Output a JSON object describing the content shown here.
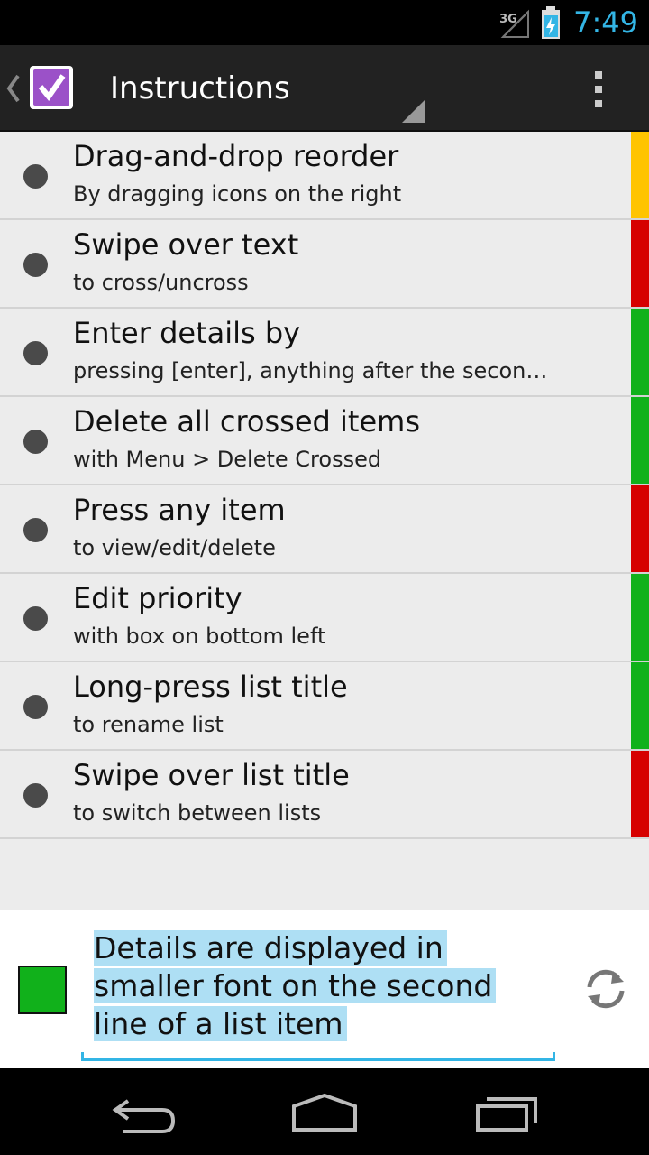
{
  "status_bar": {
    "network_type": "3G",
    "time": "7:49",
    "icons": [
      "signal-icon",
      "battery-charging-icon"
    ]
  },
  "action_bar": {
    "title": "Instructions",
    "icons": [
      "up-caret-icon",
      "app-checkbox-icon",
      "spinner-corner-icon",
      "overflow-menu-icon"
    ]
  },
  "list": {
    "items": [
      {
        "title": "Drag-and-drop reorder",
        "subtitle": "By dragging icons on the right",
        "priority_color": "#ffc400"
      },
      {
        "title": "Swipe over text",
        "subtitle": "to cross/uncross",
        "priority_color": "#d60000"
      },
      {
        "title": "Enter details by",
        "subtitle": "pressing [enter], anything after the secon…",
        "priority_color": "#11b11b"
      },
      {
        "title": "Delete all crossed items",
        "subtitle": "with Menu > Delete Crossed",
        "priority_color": "#11b11b"
      },
      {
        "title": "Press any item",
        "subtitle": "to view/edit/delete",
        "priority_color": "#d60000"
      },
      {
        "title": "Edit priority",
        "subtitle": "with box on bottom left",
        "priority_color": "#11b11b"
      },
      {
        "title": "Long-press list title",
        "subtitle": "to rename list",
        "priority_color": "#11b11b"
      },
      {
        "title": "Swipe over list title",
        "subtitle": "to switch between lists",
        "priority_color": "#d60000"
      }
    ]
  },
  "editor": {
    "priority_color": "#11b11b",
    "text_value": "Details are displayed in smaller font on the second line of a list item",
    "icons": [
      "refresh-icon"
    ]
  },
  "nav_bar": {
    "icons": [
      "back-icon",
      "home-icon",
      "recents-icon"
    ]
  },
  "colors": {
    "accent": "#33b5e5",
    "action_bar": "#222222",
    "list_background": "#ececec"
  }
}
